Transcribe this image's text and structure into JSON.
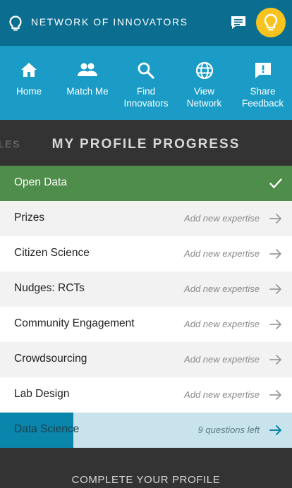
{
  "header": {
    "brand": "NETWORK OF INNOVATORS",
    "colors": {
      "topbar": "#0b6e90",
      "avatar": "#f7c41f"
    },
    "icons": {
      "logo": "lightbulb-icon",
      "chat": "chat-icon",
      "avatar": "lightbulb-icon"
    }
  },
  "nav": {
    "items": [
      {
        "label": "Home",
        "icon": "home-icon"
      },
      {
        "label": "Match Me",
        "icon": "people-icon"
      },
      {
        "label": "Find\nInnovators",
        "icon": "search-icon"
      },
      {
        "label": "View\nNetwork",
        "icon": "globe-icon"
      },
      {
        "label": "Share\nFeedback",
        "icon": "feedback-icon"
      }
    ],
    "color": "#1a9cc6"
  },
  "progress": {
    "title": "MY PROFILE PROGRESS",
    "prev_tab": "LES"
  },
  "expertise": [
    {
      "name": "Open Data",
      "status": "complete",
      "hint": ""
    },
    {
      "name": "Prizes",
      "status": "empty",
      "hint": "Add new expertise"
    },
    {
      "name": "Citizen Science",
      "status": "empty",
      "hint": "Add new expertise"
    },
    {
      "name": "Nudges: RCTs",
      "status": "empty",
      "hint": "Add new expertise"
    },
    {
      "name": "Community Engagement",
      "status": "empty",
      "hint": "Add new expertise"
    },
    {
      "name": "Crowdsourcing",
      "status": "empty",
      "hint": "Add new expertise"
    },
    {
      "name": "Lab Design",
      "status": "empty",
      "hint": "Add new expertise"
    },
    {
      "name": "Data Science",
      "status": "in-progress",
      "hint": "9 questions left",
      "progress_fraction": 0.25
    }
  ],
  "footer": {
    "cta": "COMPLETE YOUR PROFILE"
  }
}
